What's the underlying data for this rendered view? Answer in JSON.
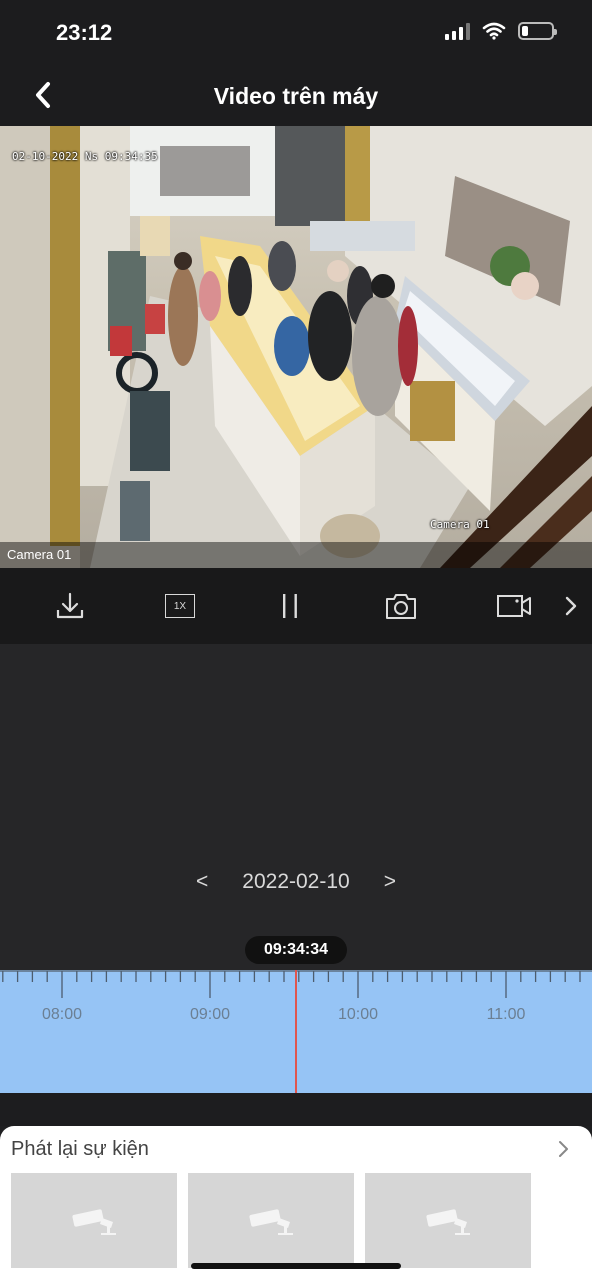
{
  "status_bar": {
    "time": "23:12",
    "icons": [
      "signal-icon",
      "wifi-icon",
      "battery-icon"
    ],
    "battery_level": 0.2
  },
  "nav": {
    "title": "Video trên máy",
    "back_icon": "chevron-left-icon"
  },
  "video": {
    "timestamp_overlay": "02-10-2022 Ns 09:34:35",
    "overlay_label": "Camera 01",
    "camera_label": "Camera 01"
  },
  "controls": {
    "items": [
      {
        "name": "download-icon"
      },
      {
        "name": "playback-speed",
        "label": "1X"
      },
      {
        "name": "pause-icon"
      },
      {
        "name": "snapshot-icon"
      },
      {
        "name": "record-icon"
      },
      {
        "name": "chevron-right-icon"
      }
    ],
    "speed_label": "1X"
  },
  "date_nav": {
    "prev": "<",
    "date": "2022-02-10",
    "next": ">"
  },
  "timeline": {
    "current_time": "09:34:34",
    "hour_labels": [
      "08:00",
      "09:00",
      "10:00",
      "11:00"
    ],
    "background_color": "#96c4f5",
    "cursor_color": "#e0564f"
  },
  "events": {
    "title": "Phát lại sự kiện",
    "thumbnail_icon": "camera-icon",
    "thumbnail_count": 3
  }
}
